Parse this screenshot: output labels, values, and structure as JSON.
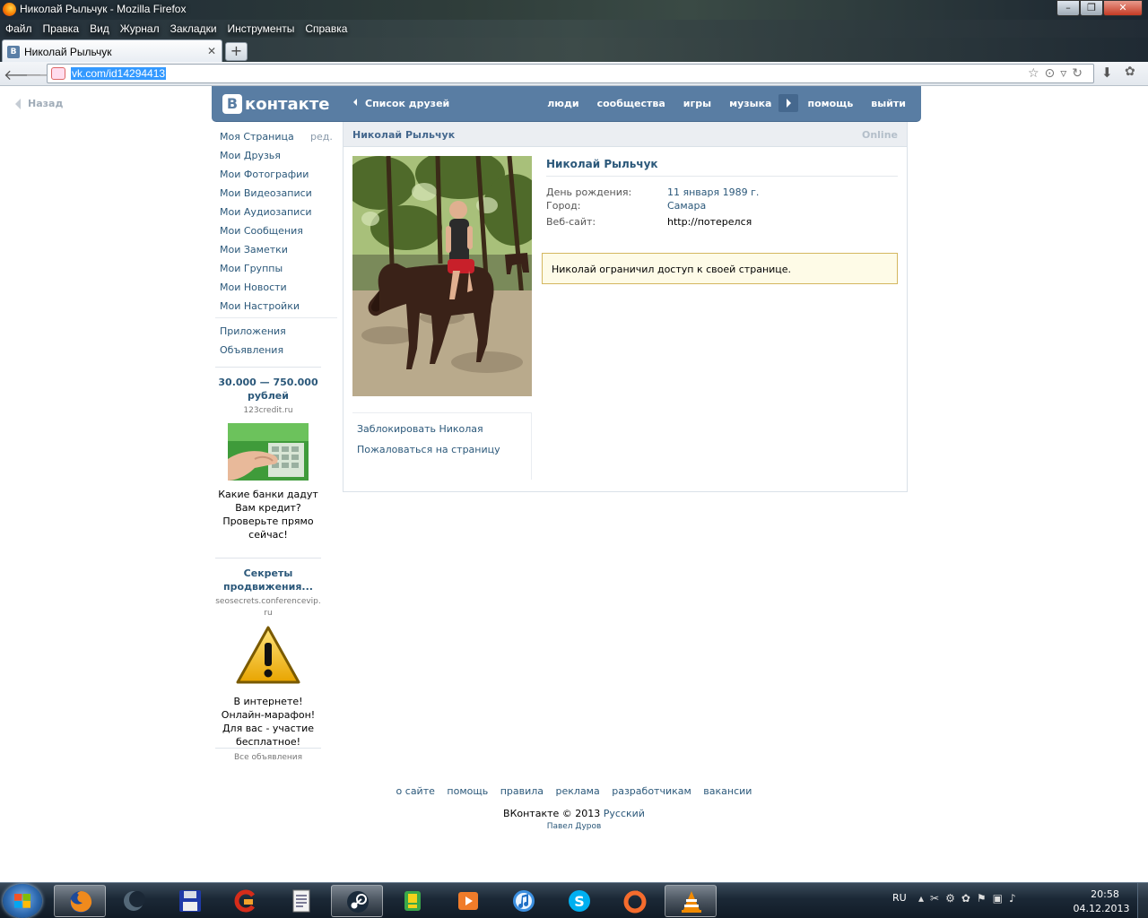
{
  "window": {
    "title": "Николай Рыльчук - Mozilla Firefox",
    "menu": [
      "Файл",
      "Правка",
      "Вид",
      "Журнал",
      "Закладки",
      "Инструменты",
      "Справка"
    ]
  },
  "browser": {
    "tab_title": "Николай Рыльчук",
    "url": "vk.com/id14294413"
  },
  "page": {
    "back_label": "Назад",
    "logo_text": "контакте",
    "logo_letter": "В",
    "friends_link": "Список друзей",
    "topnav": [
      "люди",
      "сообщества",
      "игры",
      "музыка",
      "помощь",
      "выйти"
    ],
    "sidebar": {
      "items": [
        "Моя Страница",
        "Мои Друзья",
        "Мои Фотографии",
        "Мои Видеозаписи",
        "Мои Аудиозаписи",
        "Мои Сообщения",
        "Мои Заметки",
        "Мои Группы",
        "Мои Новости",
        "Мои Настройки"
      ],
      "edit": "ред.",
      "extra": [
        "Приложения",
        "Объявления"
      ]
    },
    "ads": [
      {
        "title": "30.000 — 750.000 рублей",
        "url": "123credit.ru",
        "desc": "Какие банки дадут Вам кредит? Проверьте прямо сейчас!"
      },
      {
        "title": "Секреты продвижения...",
        "url": "seosecrets.conferencevip.ru",
        "desc": "В интернете! Онлайн-марафон! Для вас - участие бесплатное!"
      }
    ],
    "all_ads": "Все объявления",
    "profile": {
      "header_name": "Николай Рыльчук",
      "status": "Online",
      "name": "Николай Рыльчук",
      "fields": [
        {
          "label": "День рождения:",
          "value": "11 января 1989 г."
        },
        {
          "label": "Город:",
          "value": "Самара"
        },
        {
          "label": "Веб-сайт:",
          "value": "http://потерелся"
        }
      ],
      "notice": "Николай ограничил доступ к своей странице.",
      "actions": [
        "Заблокировать Николая",
        "Пожаловаться на страницу"
      ]
    },
    "footer": {
      "links": [
        "о сайте",
        "помощь",
        "правила",
        "реклама",
        "разработчикам",
        "вакансии"
      ],
      "copy": "ВКонтакте © 2013",
      "lang": "Русский",
      "author": "Павел Дуров"
    }
  },
  "taskbar": {
    "lang": "RU",
    "time": "20:58",
    "date": "04.12.2013"
  }
}
